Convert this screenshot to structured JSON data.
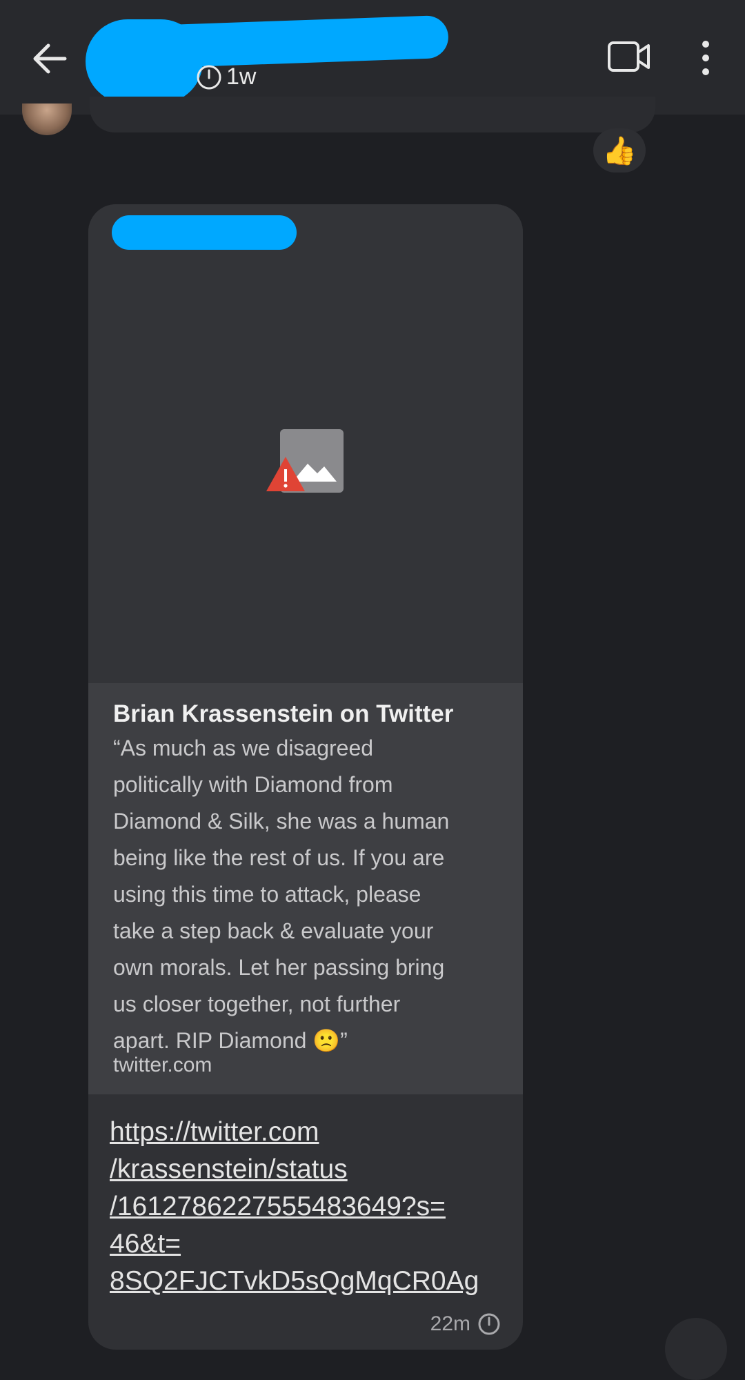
{
  "header": {
    "disappearing_timer": "1w"
  },
  "reaction": "👍",
  "message": {
    "link_preview": {
      "title": "Brian Krassenstein on Twitter",
      "description": "“As much as we disagreed\npolitically with Diamond from\nDiamond & Silk, she was a human\nbeing like the rest of us. If you are\nusing this time to attack, please\ntake a step back & evaluate your\nown morals. Let her passing bring\nus closer together, not further\napart. RIP Diamond 🙁”",
      "domain": "twitter.com"
    },
    "url": "https://twitter.com\n/krassenstein/status\n/1612786227555483649?s=\n46&t=\n8SQ2FJCTvkD5sQgMqCR0Ag",
    "time": "22m"
  },
  "colors": {
    "redaction": "#00a8ff",
    "background": "#1e1f23",
    "bubble": "#303135",
    "card": "#3e3f43"
  }
}
